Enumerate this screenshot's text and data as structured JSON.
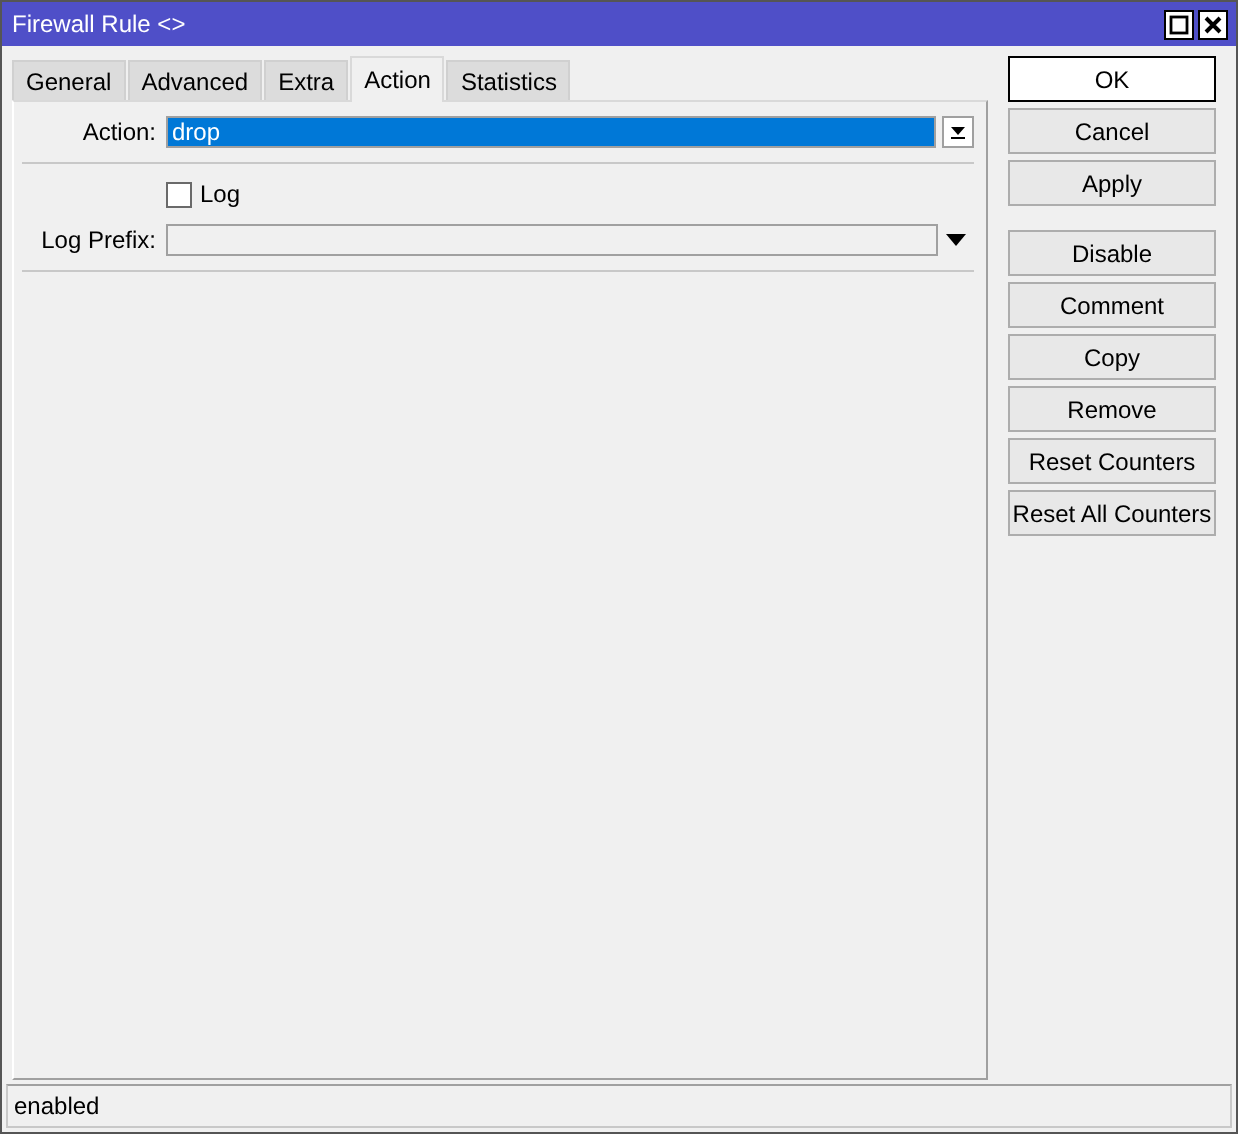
{
  "window": {
    "title": "Firewall Rule <>"
  },
  "tabs": [
    {
      "label": "General",
      "selected": false
    },
    {
      "label": "Advanced",
      "selected": false
    },
    {
      "label": "Extra",
      "selected": false
    },
    {
      "label": "Action",
      "selected": true
    },
    {
      "label": "Statistics",
      "selected": false
    }
  ],
  "form": {
    "action": {
      "label": "Action:",
      "value": "drop"
    },
    "log": {
      "label": "Log",
      "checked": false
    },
    "log_prefix": {
      "label": "Log Prefix:"
    }
  },
  "dialog_buttons": [
    {
      "label": "OK",
      "default": true
    },
    {
      "label": "Cancel",
      "default": false
    },
    {
      "label": "Apply",
      "default": false
    }
  ],
  "rule_buttons": [
    {
      "label": "Disable"
    },
    {
      "label": "Comment"
    },
    {
      "label": "Copy"
    },
    {
      "label": "Remove"
    },
    {
      "label": "Reset Counters"
    },
    {
      "label": "Reset All Counters"
    }
  ],
  "status_bar": {
    "text": "enabled"
  }
}
